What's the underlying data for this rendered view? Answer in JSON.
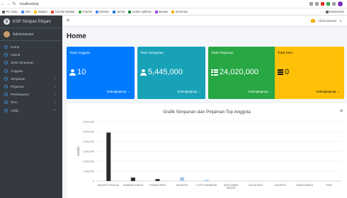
{
  "browser": {
    "url": "localhost/sp",
    "bookmarks": [
      "Pin Data",
      "SMJ",
      "Belajar",
      "Tutorial Belajar",
      "Tutorial",
      "blender",
      "Jurnal",
      "Selain Aplikasi",
      "Belajar",
      "Informasi"
    ],
    "bookmarks_right": "Bookmarks"
  },
  "sidebar": {
    "brand": "KSP Simpan Pinjam",
    "user": "Administrator",
    "items": [
      {
        "label": "Home",
        "caret": ""
      },
      {
        "label": "Userid",
        "caret": ""
      },
      {
        "label": "Jenis Simpanan",
        "caret": ""
      },
      {
        "label": "Anggota",
        "caret": ""
      },
      {
        "label": "Simpanan",
        "caret": "‹"
      },
      {
        "label": "Pinjaman",
        "caret": "‹"
      },
      {
        "label": "Pembayaran",
        "caret": "‹"
      },
      {
        "label": "SHU",
        "caret": "‹"
      },
      {
        "label": "Utility",
        "caret": "‹"
      }
    ]
  },
  "topnav": {
    "admin": "Administrator"
  },
  "page": {
    "title": "Home"
  },
  "cards": [
    {
      "title": "Total Anggota",
      "value": "10",
      "link": "Selengkapnya →",
      "color": "#007bff",
      "text_color": "#ffffff"
    },
    {
      "title": "Total Simpanan",
      "value": "5,445,000",
      "link": "Selengkapnya →",
      "color": "#17a2b8",
      "text_color": "#ffffff"
    },
    {
      "title": "Total Pinjaman",
      "value": "24,020,000",
      "link": "Selengkapnya →",
      "color": "#28a745",
      "text_color": "#ffffff"
    },
    {
      "title": "Total SHU",
      "value": "0",
      "link": "Selengkapnya →",
      "color": "#ffc107",
      "text_color": "#111111"
    }
  ],
  "chart_data": {
    "type": "bar",
    "title": "Grafik Simpanan dan Pinjaman Top Anggota",
    "ylabel": "Jumlah",
    "xlabel": "",
    "ylim": [
      0,
      6000000
    ],
    "yticks": [
      0,
      1000000,
      2000000,
      3000000,
      4000000,
      5000000,
      6000000
    ],
    "grid": true,
    "categories": [
      "SUDARTO ARIAJUL",
      "SUMARNI ANGGA",
      "KURNIA DEWI",
      "HILDAYATI",
      "LUTFI CHAIRIANA",
      "AGUS AMBIL SURYAT",
      "SULASTIANI",
      "SUKARTA",
      "RINDA WARDA",
      "RIZKI"
    ],
    "series": [
      {
        "color": "#2b2b2b",
        "values": [
          4900000,
          350000,
          200000,
          0,
          0,
          0,
          0,
          0,
          0,
          0
        ]
      },
      {
        "color": "#a8c7ea",
        "values": [
          0,
          0,
          0,
          380000,
          120000,
          0,
          0,
          0,
          0,
          0
        ]
      }
    ]
  }
}
